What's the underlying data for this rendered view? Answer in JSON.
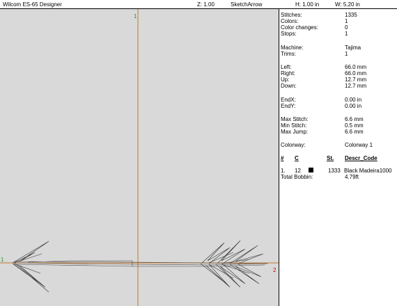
{
  "header": {
    "app_title": "Wilcom ES-65 Designer",
    "zoom": "Z: 1.00",
    "design_name": "SketchArrow",
    "height": "H: 1.00 in",
    "width": "W: 5.20 in"
  },
  "canvas": {
    "vertical_marker": "1",
    "left_marker": "1",
    "right_marker": "2",
    "colors": {
      "background": "#d9d9d9",
      "guide": "#c8782c",
      "marker_green": "#2a9a2a",
      "marker_red": "#cc0000"
    }
  },
  "stats": {
    "stitches": {
      "label": "Stitches:",
      "value": "1335"
    },
    "colors": {
      "label": "Colors:",
      "value": "1"
    },
    "color_changes": {
      "label": "Color changes:",
      "value": "0"
    },
    "stops": {
      "label": "Stops:",
      "value": "1"
    },
    "machine": {
      "label": "Machine:",
      "value": "Tajima"
    },
    "trims": {
      "label": "Trims:",
      "value": "1"
    },
    "left": {
      "label": "Left:",
      "value": "66.0 mm"
    },
    "right": {
      "label": "Right:",
      "value": "66.0 mm"
    },
    "up": {
      "label": "Up:",
      "value": "12.7 mm"
    },
    "down": {
      "label": "Down:",
      "value": "12.7 mm"
    },
    "endx": {
      "label": "EndX:",
      "value": "0.00 in"
    },
    "endy": {
      "label": "EndY:",
      "value": "0.00 in"
    },
    "max_stitch": {
      "label": "Max Stitch:",
      "value": "6.6 mm"
    },
    "min_stitch": {
      "label": "Min Stitch:",
      "value": "0.5 mm"
    },
    "max_jump": {
      "label": "Max Jump:",
      "value": "6.6 mm"
    },
    "colorway": {
      "label": "Colorway:",
      "value": "Colorway 1"
    }
  },
  "color_table": {
    "headers": {
      "num": "#",
      "c": "C",
      "st": "St.",
      "descr": "Descr_Code"
    },
    "rows": [
      {
        "num": "1.",
        "c": "12",
        "swatch_color": "#000000",
        "st": "1333",
        "descr": "Black Madeira1000"
      }
    ],
    "total_bobbin_label": "Total Bobbin:",
    "total_bobbin_value": "4.79ft"
  }
}
